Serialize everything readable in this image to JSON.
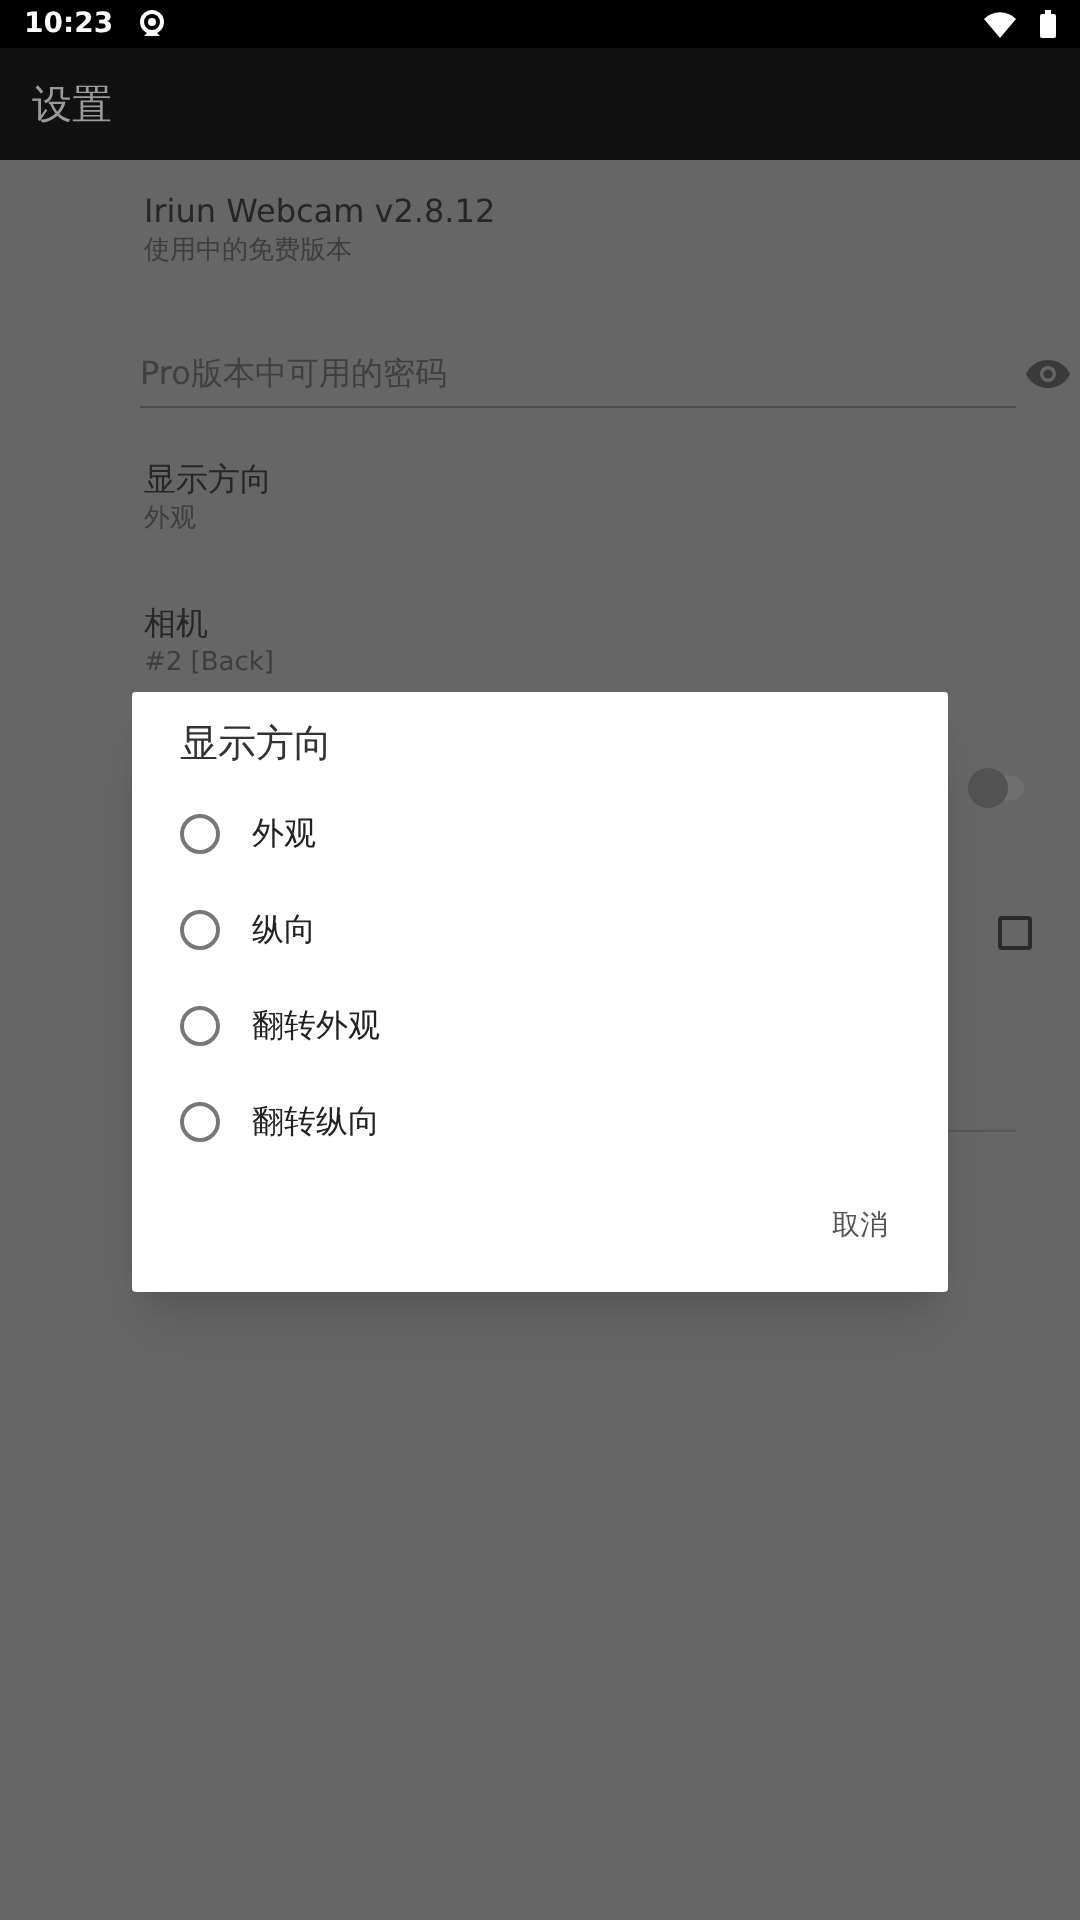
{
  "status_bar": {
    "time": "10:23"
  },
  "app_bar": {
    "title": "设置"
  },
  "settings": [
    {
      "kind": "info",
      "title": "Iriun Webcam v2.8.12",
      "subtitle": "使用中的免费版本"
    },
    {
      "kind": "password",
      "placeholder": "Pro版本中可用的密码"
    },
    {
      "kind": "info",
      "title": "显示方向",
      "subtitle": "外观"
    },
    {
      "kind": "info",
      "title": "相机",
      "subtitle": "#2 [Back]"
    },
    {
      "kind": "switch",
      "on": false
    },
    {
      "kind": "checkbox",
      "checked": false
    },
    {
      "kind": "field"
    }
  ],
  "dialog": {
    "title": "显示方向",
    "options": [
      {
        "label": "外观",
        "selected": false
      },
      {
        "label": "纵向",
        "selected": false
      },
      {
        "label": "翻转外观",
        "selected": false
      },
      {
        "label": "翻转纵向",
        "selected": false
      }
    ],
    "cancel": "取消"
  }
}
